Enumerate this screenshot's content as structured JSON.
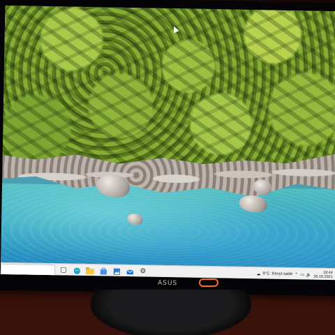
{
  "taskbar": {
    "weather": {
      "temperature": "9°C",
      "condition": "Kevyt sade"
    },
    "clock": {
      "time": "18:44",
      "date": "26.10.2021"
    },
    "pinned_apps": [
      "task-view",
      "edge",
      "file-explorer",
      "store",
      "photos",
      "mail",
      "settings"
    ]
  },
  "monitor": {
    "brand": "ASUS"
  },
  "colors": {
    "taskbar_bg": "#f0f0f0",
    "power_led": "#ff6a2b"
  }
}
